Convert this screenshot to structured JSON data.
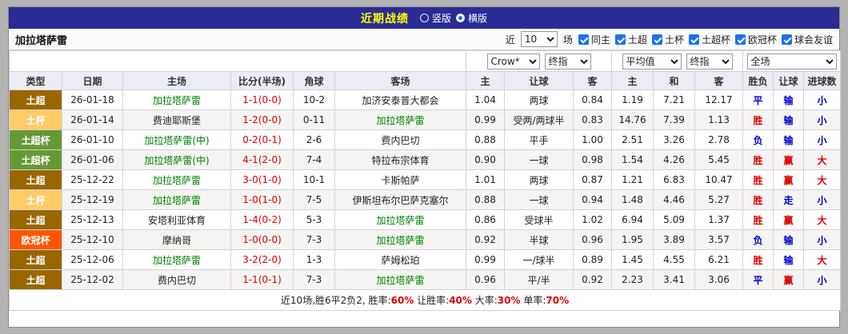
{
  "titlebar": {
    "title": "近期战绩",
    "options": [
      {
        "label": "竖版",
        "selected": false
      },
      {
        "label": "横版",
        "selected": true
      }
    ]
  },
  "filterbar": {
    "team": "加拉塔萨雷",
    "recent_label": "近",
    "count": "10",
    "matches_label": "场",
    "checkboxes": [
      {
        "label": "同主",
        "checked": true
      },
      {
        "label": "土超",
        "checked": true
      },
      {
        "label": "土杯",
        "checked": true
      },
      {
        "label": "土超杯",
        "checked": true
      },
      {
        "label": "欧冠杯",
        "checked": true
      },
      {
        "label": "球会友谊",
        "checked": true
      }
    ]
  },
  "selects": {
    "asia_provider": "Crow*",
    "asia_stage": "终指",
    "euro_provider": "平均值",
    "euro_stage": "终指",
    "scope": "全场"
  },
  "columns": [
    "类型",
    "日期",
    "主场",
    "比分(半场)",
    "角球",
    "客场",
    "主",
    "让球",
    "客",
    "主",
    "和",
    "客",
    "胜负",
    "让球",
    "进球数"
  ],
  "type_colors": {
    "土超": "#996600",
    "土杯": "#ffcc66",
    "土超杯": "#669933",
    "欧冠杯": "#ff5500"
  },
  "result_colors": {
    "胜": "#e00000",
    "赢": "#e00000",
    "大": "#e00000",
    "负": "#0000cc",
    "输": "#0000cc",
    "小": "#0000cc",
    "平": "#0000cc",
    "走": "#0000cc"
  },
  "rows": [
    {
      "type": "土超",
      "date": "26-01-18",
      "home": "加拉塔萨雷",
      "home_self": true,
      "score": "1-1(0-0)",
      "corners": "10-2",
      "away": "加济安泰普大都会",
      "away_self": false,
      "asia_home": "1.04",
      "handicap": "两球",
      "asia_away": "0.84",
      "euro_home": "1.19",
      "euro_draw": "7.21",
      "euro_away": "12.17",
      "result": "平",
      "handicap_result": "输",
      "goals_result": "小"
    },
    {
      "type": "土杯",
      "date": "26-01-14",
      "home": "费迪耶斯堡",
      "home_self": false,
      "score": "1-2(0-0)",
      "corners": "0-11",
      "away": "加拉塔萨雷",
      "away_self": true,
      "asia_home": "0.99",
      "handicap": "受两/两球半",
      "asia_away": "0.83",
      "euro_home": "14.76",
      "euro_draw": "7.39",
      "euro_away": "1.13",
      "result": "胜",
      "handicap_result": "输",
      "goals_result": "小"
    },
    {
      "type": "土超杯",
      "date": "26-01-10",
      "home": "加拉塔萨雷(中)",
      "home_self": true,
      "score": "0-2(0-1)",
      "corners": "2-6",
      "away": "费内巴切",
      "away_self": false,
      "asia_home": "0.88",
      "handicap": "平手",
      "asia_away": "1.00",
      "euro_home": "2.51",
      "euro_draw": "3.26",
      "euro_away": "2.78",
      "result": "负",
      "handicap_result": "输",
      "goals_result": "小"
    },
    {
      "type": "土超杯",
      "date": "26-01-06",
      "home": "加拉塔萨雷(中)",
      "home_self": true,
      "score": "4-1(2-0)",
      "corners": "7-4",
      "away": "特拉布宗体育",
      "away_self": false,
      "asia_home": "0.90",
      "handicap": "一球",
      "asia_away": "0.98",
      "euro_home": "1.54",
      "euro_draw": "4.26",
      "euro_away": "5.45",
      "result": "胜",
      "handicap_result": "赢",
      "goals_result": "大"
    },
    {
      "type": "土超",
      "date": "25-12-22",
      "home": "加拉塔萨雷",
      "home_self": true,
      "score": "3-0(1-0)",
      "corners": "10-1",
      "away": "卡斯帕萨",
      "away_self": false,
      "asia_home": "1.01",
      "handicap": "两球",
      "asia_away": "0.87",
      "euro_home": "1.21",
      "euro_draw": "6.83",
      "euro_away": "10.47",
      "result": "胜",
      "handicap_result": "赢",
      "goals_result": "大"
    },
    {
      "type": "土杯",
      "date": "25-12-19",
      "home": "加拉塔萨雷",
      "home_self": true,
      "score": "1-0(1-0)",
      "corners": "7-5",
      "away": "伊斯坦布尔巴萨克塞尔",
      "away_self": false,
      "asia_home": "0.88",
      "handicap": "一球",
      "asia_away": "0.94",
      "euro_home": "1.48",
      "euro_draw": "4.46",
      "euro_away": "5.27",
      "result": "胜",
      "handicap_result": "走",
      "goals_result": "小"
    },
    {
      "type": "土超",
      "date": "25-12-13",
      "home": "安塔利亚体育",
      "home_self": false,
      "score": "1-4(0-2)",
      "corners": "5-3",
      "away": "加拉塔萨雷",
      "away_self": true,
      "asia_home": "0.86",
      "handicap": "受球半",
      "asia_away": "1.02",
      "euro_home": "6.94",
      "euro_draw": "5.09",
      "euro_away": "1.37",
      "result": "胜",
      "handicap_result": "赢",
      "goals_result": "大"
    },
    {
      "type": "欧冠杯",
      "date": "25-12-10",
      "home": "摩纳哥",
      "home_self": false,
      "score": "1-0(0-0)",
      "corners": "7-3",
      "away": "加拉塔萨雷",
      "away_self": true,
      "asia_home": "0.92",
      "handicap": "半球",
      "asia_away": "0.96",
      "euro_home": "1.95",
      "euro_draw": "3.89",
      "euro_away": "3.57",
      "result": "负",
      "handicap_result": "输",
      "goals_result": "小"
    },
    {
      "type": "土超",
      "date": "25-12-06",
      "home": "加拉塔萨雷",
      "home_self": true,
      "score": "3-2(2-0)",
      "corners": "1-3",
      "away": "萨姆松珀",
      "away_self": false,
      "asia_home": "0.99",
      "handicap": "一/球半",
      "asia_away": "0.89",
      "euro_home": "1.45",
      "euro_draw": "4.55",
      "euro_away": "6.21",
      "result": "胜",
      "handicap_result": "输",
      "goals_result": "大"
    },
    {
      "type": "土超",
      "date": "25-12-02",
      "home": "费内巴切",
      "home_self": false,
      "score": "1-1(0-1)",
      "corners": "7-3",
      "away": "加拉塔萨雷",
      "away_self": true,
      "asia_home": "0.96",
      "handicap": "平/半",
      "asia_away": "0.92",
      "euro_home": "2.23",
      "euro_draw": "3.41",
      "euro_away": "3.06",
      "result": "平",
      "handicap_result": "赢",
      "goals_result": "小"
    }
  ],
  "footer": {
    "segments": [
      {
        "text": "近10场,胜6平2负2, 胜率:",
        "red": false
      },
      {
        "text": "60%",
        "red": true
      },
      {
        "text": " 让胜率:",
        "red": false
      },
      {
        "text": "40%",
        "red": true
      },
      {
        "text": " 大率:",
        "red": false
      },
      {
        "text": "30%",
        "red": true
      },
      {
        "text": " 单率:",
        "red": false
      },
      {
        "text": "70%",
        "red": true
      }
    ]
  }
}
